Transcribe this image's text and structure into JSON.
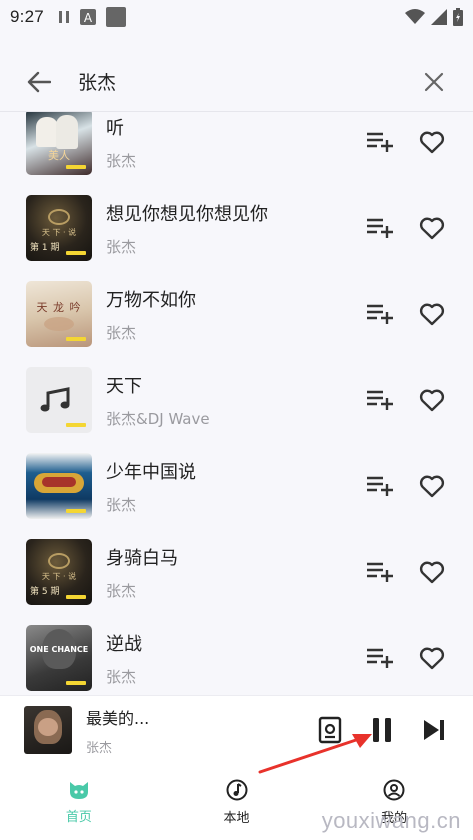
{
  "status_bar": {
    "time": "9:27",
    "icons": [
      "pause-icon",
      "font-a-icon",
      "app-square-icon",
      "wifi-icon",
      "signal-icon",
      "battery-icon"
    ]
  },
  "search": {
    "query": "张杰",
    "back_icon": "arrow-left-icon",
    "clear_icon": "close-icon"
  },
  "songs": [
    {
      "title": "听",
      "artist": "张杰",
      "cover_text": "美人"
    },
    {
      "title": "想见你想见你想见你",
      "artist": "张杰",
      "cover_text": "第 1 期"
    },
    {
      "title": "万物不如你",
      "artist": "张杰",
      "cover_text": "天 龙 吟"
    },
    {
      "title": "天下",
      "artist": "张杰&DJ Wave",
      "cover_text": ""
    },
    {
      "title": "少年中国说",
      "artist": "张杰",
      "cover_text": ""
    },
    {
      "title": "身骑白马",
      "artist": "张杰",
      "cover_text": "第 5 期"
    },
    {
      "title": "逆战",
      "artist": "张杰",
      "cover_text": "ONE CHANCE"
    }
  ],
  "player": {
    "title": "最美的...",
    "artist": "张杰",
    "controls": [
      "playlist-book-icon",
      "pause-icon",
      "skip-next-icon"
    ]
  },
  "nav": [
    {
      "label": "首页",
      "icon": "cat-face-icon",
      "active": true
    },
    {
      "label": "本地",
      "icon": "music-note-circle-icon",
      "active": false
    },
    {
      "label": "我的",
      "icon": "user-circle-icon",
      "active": false
    }
  ],
  "watermark": "youxiwang.cn",
  "colors": {
    "accent": "#49c9a8",
    "tag": "#f4d633",
    "arrow": "#e8322b"
  }
}
